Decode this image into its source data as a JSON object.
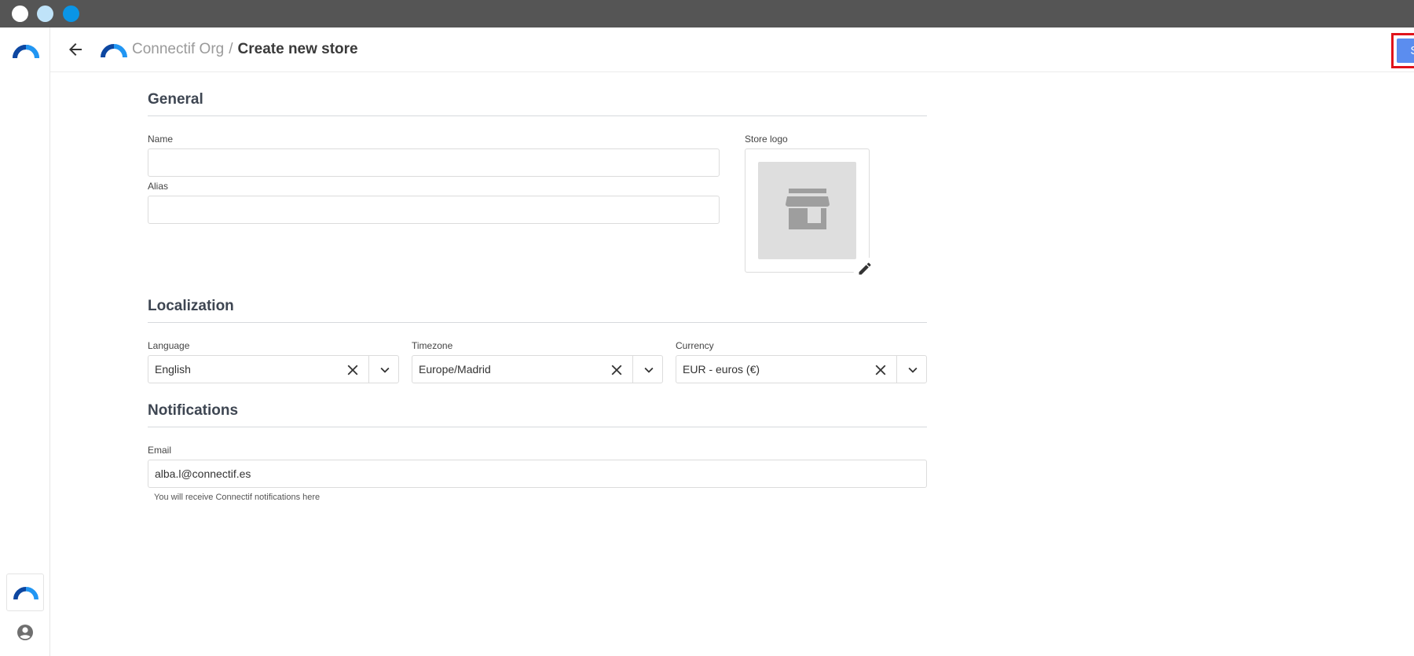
{
  "window": {
    "controls": [
      "close",
      "minimize",
      "maximize"
    ]
  },
  "header": {
    "org_name": "Connectif Org",
    "separator": "/",
    "page_title": "Create new store",
    "save_label": "Save"
  },
  "general": {
    "title": "General",
    "name_label": "Name",
    "name_value": "",
    "alias_label": "Alias",
    "alias_value": "",
    "store_logo_label": "Store logo"
  },
  "localization": {
    "title": "Localization",
    "language_label": "Language",
    "language_value": "English",
    "timezone_label": "Timezone",
    "timezone_value": "Europe/Madrid",
    "currency_label": "Currency",
    "currency_value": "EUR - euros (€)"
  },
  "notifications": {
    "title": "Notifications",
    "email_label": "Email",
    "email_value": "alba.l@connectif.es",
    "email_helper": "You will receive Connectif notifications here"
  },
  "colors": {
    "accent": "#5b8def",
    "brand_dark": "#0d47a1",
    "brand_light": "#2196f3",
    "highlight": "#e0141b"
  },
  "icons": [
    "connectif-logo-icon",
    "back-arrow-icon",
    "store-icon",
    "pencil-icon",
    "close-icon",
    "chevron-down-icon",
    "user-account-icon"
  ]
}
